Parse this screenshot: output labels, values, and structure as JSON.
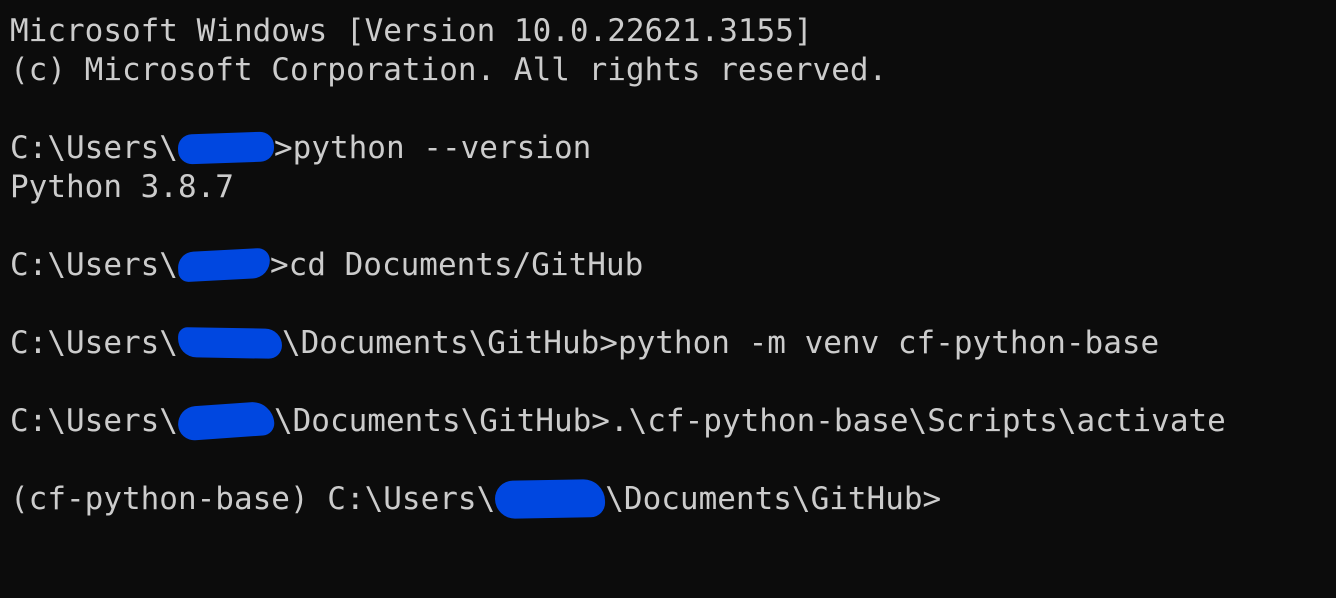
{
  "terminal": {
    "header_line_1": "Microsoft Windows [Version 10.0.22621.3155]",
    "header_line_2": "(c) Microsoft Corporation. All rights reserved.",
    "commands": [
      {
        "prompt_prefix": "C:\\Users\\",
        "prompt_suffix": ">",
        "command": "python --version",
        "output": "Python 3.8.7"
      },
      {
        "prompt_prefix": "C:\\Users\\",
        "prompt_suffix": ">",
        "command": "cd Documents/GitHub"
      },
      {
        "prompt_prefix": "C:\\Users\\",
        "prompt_suffix": "\\Documents\\GitHub>",
        "command": "python -m venv cf-python-base"
      },
      {
        "prompt_prefix": "C:\\Users\\",
        "prompt_suffix": "\\Documents\\GitHub>",
        "command": ".\\cf-python-base\\Scripts\\activate"
      }
    ],
    "active_prompt": {
      "venv": "(cf-python-base) ",
      "prompt_prefix": "C:\\Users\\",
      "prompt_suffix": "\\Documents\\GitHub>"
    }
  },
  "colors": {
    "background": "#0c0c0c",
    "text": "#cccccc",
    "redaction": "#0047e0"
  }
}
